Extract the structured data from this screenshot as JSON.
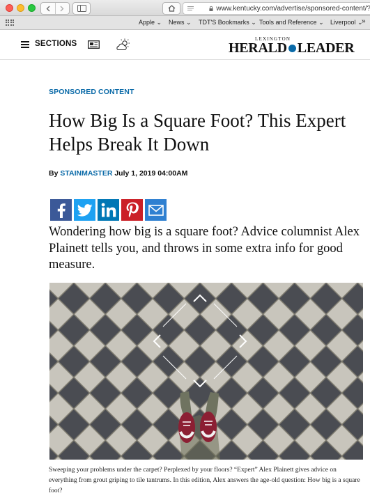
{
  "browser": {
    "url": "www.kentucky.com/advertise/sponsored-content/?",
    "bookmarks": [
      "Apple",
      "News",
      "TDT'S Bookmarks",
      "Tools and Reference",
      "Liverpool"
    ]
  },
  "site": {
    "sections_label": "SECTIONS",
    "logo_small": "LEXINGTON",
    "logo_left": "HERALD",
    "logo_right": "LEADER",
    "brand_color": "#0a6aa8"
  },
  "article": {
    "label": "SPONSORED CONTENT",
    "title": "How Big Is a Square Foot? This Expert Helps Break It Down",
    "byline_prefix": "By",
    "author": "STAINMASTER",
    "date": "July 1, 2019 04:00AM",
    "lead": "Wondering how big is a square foot? Advice columnist Alex Plainett tells you, and throws in some extra info for good measure.",
    "caption": "Sweeping your problems under the carpet? Perplexed by your floors? “Expert” Alex Plainett gives advice on everything from grout griping to tile tantrums. In this edition, Alex answers the age-old question: How big is a square foot?"
  },
  "share": [
    {
      "name": "facebook",
      "color": "#3b5998"
    },
    {
      "name": "twitter",
      "color": "#1da1f2"
    },
    {
      "name": "linkedin",
      "color": "#0077b5"
    },
    {
      "name": "pinterest",
      "color": "#cb2027"
    },
    {
      "name": "email",
      "color": "#2f80d1"
    }
  ]
}
